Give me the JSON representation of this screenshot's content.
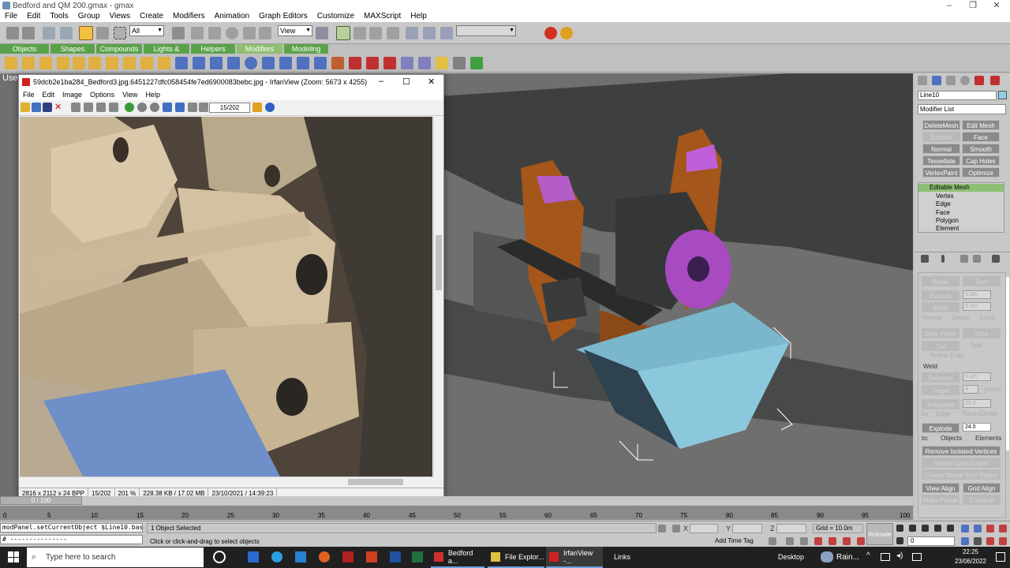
{
  "window": {
    "title": "Bedford and QM 200.gmax - gmax",
    "minimize": "–",
    "maximize": "❐",
    "close": "✕"
  },
  "menu": [
    "File",
    "Edit",
    "Tools",
    "Group",
    "Views",
    "Create",
    "Modifiers",
    "Animation",
    "Graph Editors",
    "Customize",
    "MAXScript",
    "Help"
  ],
  "toolbar": {
    "selection_filter": "All",
    "ref_coord": "View"
  },
  "tabs": [
    "Objects",
    "Shapes",
    "Compounds",
    "Lights & Cameras",
    "Helpers",
    "Modifiers",
    "Modeling"
  ],
  "viewport": {
    "label": "Use"
  },
  "irfanview": {
    "title": "59dcb2e1ba284_Bedford3.jpg.6451227dfc058454fe7ed6900083bebc.jpg - IrfanView (Zoom: 5673 x 4255)",
    "menu": [
      "File",
      "Edit",
      "Image",
      "Options",
      "View",
      "Help"
    ],
    "page_field": "15/202",
    "status": [
      "2816 x 2112 x 24 BPP",
      "15/202",
      "201 %",
      "228.38 KB / 17.02 MB",
      "23/10/2021 / 14:39:23"
    ]
  },
  "command_panel": {
    "object_name": "Line10",
    "modifier_list": "Modifier List",
    "buttons": [
      {
        "label": "DeleteMesh",
        "dim": false
      },
      {
        "label": "Edit Mesh",
        "dim": false
      },
      {
        "label": "Extrude",
        "dim": true
      },
      {
        "label": "Face Extrude",
        "dim": false
      },
      {
        "label": "Normal",
        "dim": false
      },
      {
        "label": "Smooth",
        "dim": false
      },
      {
        "label": "Tessellate",
        "dim": false
      },
      {
        "label": "Cap Holes",
        "dim": false
      },
      {
        "label": "VertexPaint",
        "dim": false
      },
      {
        "label": "Optimize",
        "dim": false
      }
    ],
    "stack": [
      "Editable Mesh",
      "Vertex",
      "Edge",
      "Face",
      "Polygon",
      "Element"
    ],
    "rollout": {
      "break": "Break",
      "turn": "Turn",
      "extrude": "Extrude",
      "extrude_val": "0.0m",
      "bevel": "Bevel",
      "bevel_val": "0.0m",
      "normal": "Normal",
      "group": "Group",
      "local": "Local",
      "slice_plane": "Slice Plane",
      "slice": "Slice",
      "cut": "Cut",
      "split": "Split",
      "refine_ends": "Refine Ends",
      "weld": "Weld",
      "selected": "Selected",
      "selected_val": "0.1m",
      "target": "Target",
      "target_val": "4",
      "pixels": "pixels",
      "tessellate": "Tessellate",
      "tess_val": "25.0",
      "by": "by",
      "edge": "Edge",
      "face_center": "Face-Center",
      "explode": "Explode",
      "explode_val": "24.0",
      "to": "to:",
      "objects": "Objects",
      "elements": "Elements",
      "remove_isolated": "Remove Isolated Vertices",
      "select_open": "Select Open Edges",
      "create_shape": "Create Shape from Edges",
      "view_align": "View Align",
      "grid_align": "Grid Align",
      "make_planar": "Make Planar",
      "collapse": "Collapse"
    }
  },
  "timeline": {
    "frame": "0 / 100",
    "ticks": [
      "0",
      "5",
      "10",
      "15",
      "20",
      "25",
      "30",
      "35",
      "40",
      "45",
      "50",
      "55",
      "60",
      "65",
      "70",
      "75",
      "80",
      "85",
      "90",
      "95",
      "100"
    ]
  },
  "statusbar": {
    "script": "modPanel.setCurrentObject $Line10.base",
    "script2": "# ---------------",
    "selected": "1 Object Selected",
    "prompt": "Click or click-and-drag to select objects",
    "x": "X",
    "y": "Y",
    "z": "Z",
    "grid": "Grid = 10.0m",
    "add_time_tag": "Add Time Tag",
    "animate": "Animate",
    "frame_field": "0"
  },
  "taskbar": {
    "search": "Type here to search",
    "apps": [
      "Bedford a...",
      "File Explor...",
      "IrfanView -..."
    ],
    "links": "Links",
    "desktop": "Desktop",
    "weather": "Rain...",
    "time": "22:25",
    "date": "23/06/2022"
  }
}
